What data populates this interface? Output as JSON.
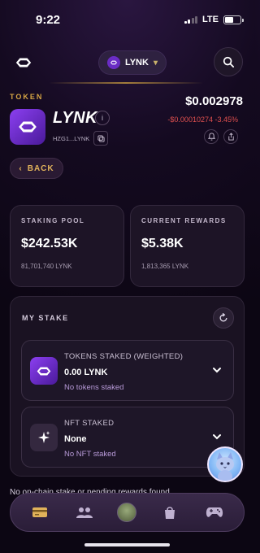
{
  "status_bar": {
    "time": "9:22",
    "network": "LTE"
  },
  "header": {
    "selected_token": "LYNK"
  },
  "token": {
    "section_label": "TOKEN",
    "name": "LYNK",
    "address": "HZG1...LYNK",
    "price": "$0.002978",
    "price_change": "-$0.00010274 -3.45%"
  },
  "back_label": "BACK",
  "stats": {
    "staking_pool": {
      "label": "STAKING POOL",
      "value": "$242.53K",
      "sub": "81,701,740 LYNK"
    },
    "current_rewards": {
      "label": "CURRENT REWARDS",
      "value": "$5.38K",
      "sub": "1,813,365 LYNK"
    }
  },
  "my_stake": {
    "title": "MY STAKE",
    "tokens": {
      "title": "TOKENS STAKED (WEIGHTED)",
      "value": "0.00 LYNK",
      "sub": "No tokens staked"
    },
    "nft": {
      "title": "NFT STAKED",
      "value": "None",
      "sub": "No NFT staked"
    }
  },
  "notice": "No on-chain stake or pending rewards found.",
  "colors": {
    "accent_gold": "#d6a544",
    "negative": "#e0504f",
    "brand_purple": "#8b3ff0"
  },
  "nav": [
    "wallet-icon",
    "community-icon",
    "profile-avatar",
    "shop-icon",
    "games-icon"
  ]
}
